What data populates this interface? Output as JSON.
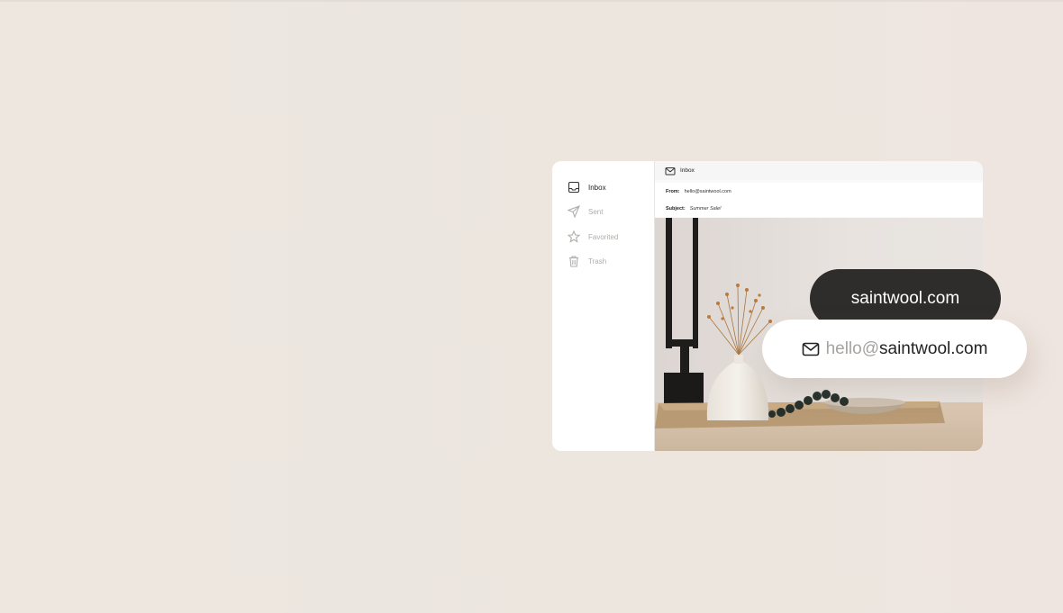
{
  "sidebar": {
    "items": [
      {
        "label": "Inbox",
        "icon": "inbox-icon",
        "active": true
      },
      {
        "label": "Sent",
        "icon": "send-icon",
        "active": false
      },
      {
        "label": "Favorited",
        "icon": "star-icon",
        "active": false
      },
      {
        "label": "Trash",
        "icon": "trash-icon",
        "active": false
      }
    ]
  },
  "mail": {
    "header_title": "Inbox",
    "from_label": "From:",
    "from_value": "hello@saintwool.com",
    "subject_label": "Subject:",
    "subject_value": "Summer Sale!"
  },
  "domain_pill": {
    "text": "saintwool.com"
  },
  "email_pill": {
    "prefix": "hello@",
    "domain": "saintwool.com"
  },
  "colors": {
    "background": "#ede7e0",
    "dark_pill": "#2f2d2b",
    "muted_text": "#a6a3a0"
  }
}
